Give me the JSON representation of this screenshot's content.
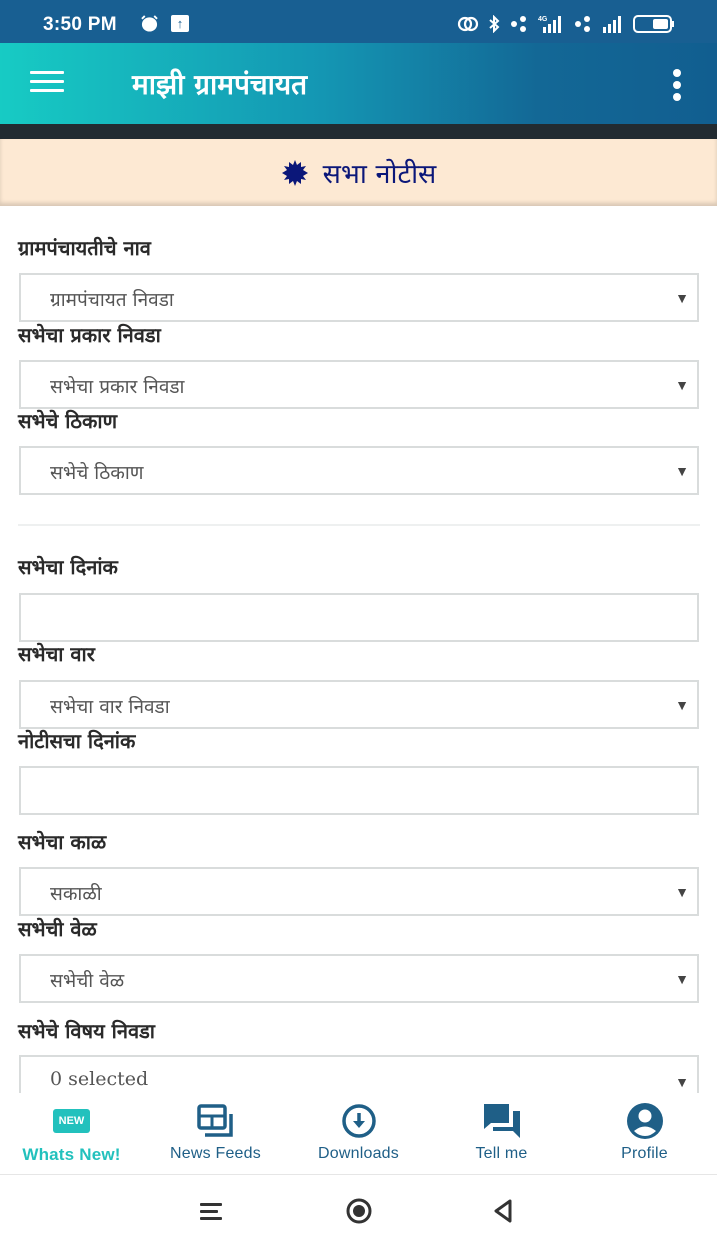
{
  "status_bar": {
    "time": "3:50 PM",
    "left_icons": [
      "alarm-icon",
      "upload-icon"
    ],
    "right_icons": [
      "link-icon",
      "bluetooth-icon",
      "dots-icon",
      "signal-4g-icon",
      "dots-icon",
      "signal-icon",
      "battery-icon"
    ],
    "network_label": "4G"
  },
  "app_bar": {
    "title": "माझी ग्रामपंचायत",
    "menu_icon": "hamburger-menu-icon",
    "overflow_icon": "more-vert-icon"
  },
  "banner": {
    "icon": "starburst-icon",
    "title": "सभा नोटीस"
  },
  "form": {
    "fields": [
      {
        "label": "ग्रामपंचायतीचे नाव",
        "type": "select",
        "value": "ग्रामपंचायत निवडा"
      },
      {
        "label": "सभेचा प्रकार निवडा",
        "type": "select",
        "value": "सभेचा प्रकार निवडा"
      },
      {
        "label": "सभेचे ठिकाण",
        "type": "select",
        "value": "सभेचे ठिकाण"
      },
      {
        "label": "सभेचा दिनांक",
        "type": "input",
        "value": ""
      },
      {
        "label": "सभेचा वार",
        "type": "select",
        "value": "सभेचा वार निवडा"
      },
      {
        "label": "नोटीसचा दिनांक",
        "type": "input",
        "value": ""
      },
      {
        "label": "सभेचा काळ",
        "type": "select",
        "value": "सकाळी"
      },
      {
        "label": "सभेची वेळ",
        "type": "select",
        "value": "सभेची वेळ"
      },
      {
        "label": "सभेचे विषय निवडा",
        "type": "multiselect",
        "value": "0 selected"
      }
    ],
    "caret": "▼"
  },
  "bottom_nav": {
    "items": [
      {
        "label": "Whats New!",
        "icon": "new-badge-icon",
        "badge": "NEW",
        "active": true
      },
      {
        "label": "News Feeds",
        "icon": "news-feed-icon",
        "active": false
      },
      {
        "label": "Downloads",
        "icon": "download-icon",
        "active": false
      },
      {
        "label": "Tell me",
        "icon": "chat-icon",
        "active": false
      },
      {
        "label": "Profile",
        "icon": "profile-icon",
        "active": false
      }
    ]
  },
  "colors": {
    "status_bar": "#185f92",
    "app_bar_start": "#17cbc4",
    "app_bar_end": "#115e90",
    "banner_bg": "#fde9d3",
    "banner_text": "#0b1779",
    "nav_active": "#22c1bd",
    "nav_inactive": "#1f5f87"
  }
}
